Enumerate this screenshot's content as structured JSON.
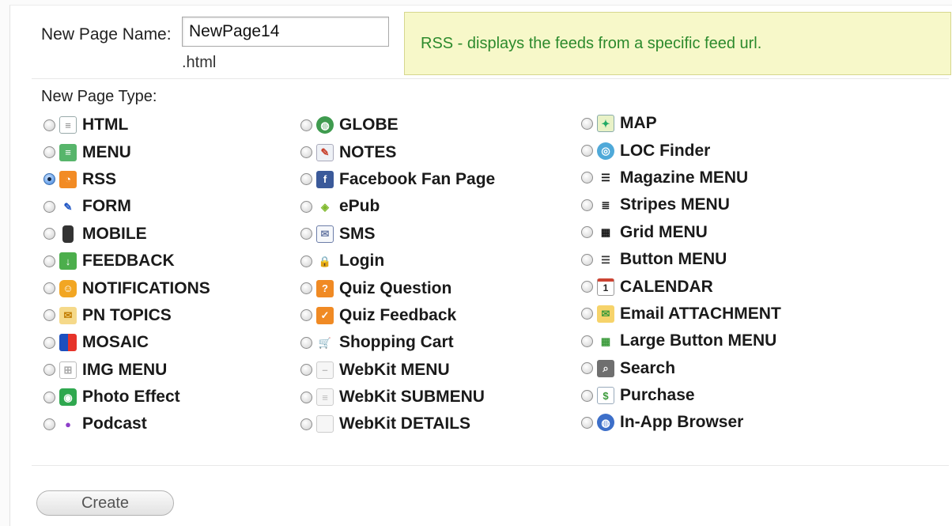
{
  "form": {
    "name_label": "New Page Name:",
    "name_value": "NewPage14",
    "extension": ".html",
    "description": "RSS - displays the feeds from a specific feed url.",
    "type_label": "New Page Type:",
    "create_label": "Create"
  },
  "colors": {
    "description_bg": "#f7f8c9",
    "description_text": "#2c8a2c",
    "radio_selected": "#3c76c4"
  },
  "columns": [
    [
      {
        "label": "HTML",
        "icon": "document-icon"
      },
      {
        "label": "MENU",
        "icon": "menu-list-icon"
      },
      {
        "label": "RSS",
        "icon": "rss-icon",
        "selected": true
      },
      {
        "label": "FORM",
        "icon": "pencil-icon"
      },
      {
        "label": "MOBILE",
        "icon": "phone-icon"
      },
      {
        "label": "FEEDBACK",
        "icon": "feedback-arrow-icon"
      },
      {
        "label": "NOTIFICATIONS",
        "icon": "notification-icon"
      },
      {
        "label": "PN TOPICS",
        "icon": "envelope-topics-icon"
      },
      {
        "label": "MOSAIC",
        "icon": "mosaic-icon"
      },
      {
        "label": "IMG MENU",
        "icon": "image-grid-icon"
      },
      {
        "label": "Photo Effect",
        "icon": "camera-icon"
      },
      {
        "label": "Podcast",
        "icon": "microphone-icon"
      }
    ],
    [
      {
        "label": "GLOBE",
        "icon": "globe-icon"
      },
      {
        "label": "NOTES",
        "icon": "notes-icon"
      },
      {
        "label": "Facebook Fan Page",
        "icon": "facebook-icon"
      },
      {
        "label": "ePub",
        "icon": "epub-icon"
      },
      {
        "label": "SMS",
        "icon": "envelope-icon"
      },
      {
        "label": "Login",
        "icon": "lock-icon"
      },
      {
        "label": "Quiz Question",
        "icon": "quiz-question-icon"
      },
      {
        "label": "Quiz Feedback",
        "icon": "quiz-feedback-icon"
      },
      {
        "label": "Shopping Cart",
        "icon": "cart-icon"
      },
      {
        "label": "WebKit MENU",
        "icon": "webkit-menu-icon"
      },
      {
        "label": "WebKit SUBMENU",
        "icon": "webkit-submenu-icon"
      },
      {
        "label": "WebKit DETAILS",
        "icon": "webkit-details-icon"
      }
    ],
    [
      {
        "label": "MAP",
        "icon": "map-icon"
      },
      {
        "label": "LOC Finder",
        "icon": "location-icon"
      },
      {
        "label": "Magazine MENU",
        "icon": "magazine-list-icon"
      },
      {
        "label": "Stripes MENU",
        "icon": "stripes-icon"
      },
      {
        "label": "Grid MENU",
        "icon": "grid-icon"
      },
      {
        "label": "Button MENU",
        "icon": "button-menu-icon"
      },
      {
        "label": "CALENDAR",
        "icon": "calendar-icon",
        "icon_text": "1"
      },
      {
        "label": "Email ATTACHMENT",
        "icon": "email-attachment-icon"
      },
      {
        "label": "Large Button MENU",
        "icon": "large-grid-icon"
      },
      {
        "label": "Search",
        "icon": "search-icon"
      },
      {
        "label": "Purchase",
        "icon": "dollar-icon",
        "icon_text": "$"
      },
      {
        "label": "In-App Browser",
        "icon": "browser-icon"
      }
    ]
  ]
}
